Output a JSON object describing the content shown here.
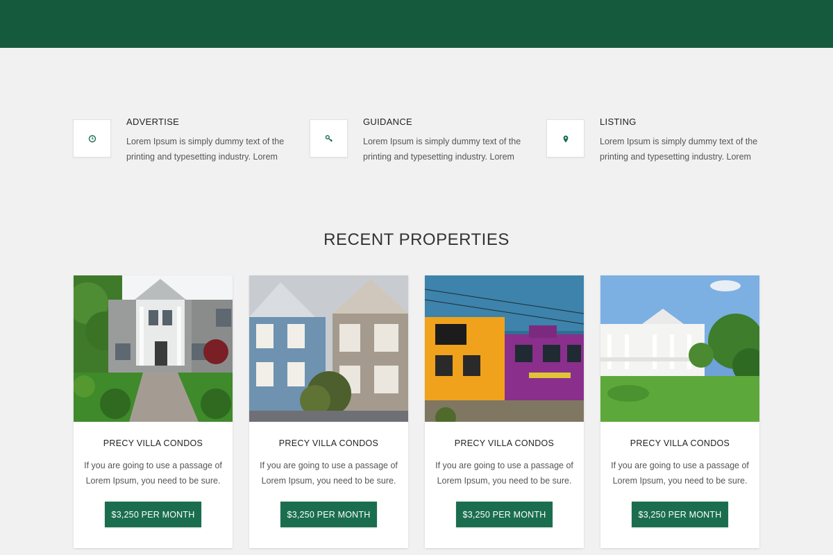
{
  "colors": {
    "header": "#165a3d",
    "accent": "#1a6e4f",
    "background": "#f1f1f1"
  },
  "features": [
    {
      "icon": "clock-icon",
      "title": "ADVERTISE",
      "text": "Lorem Ipsum is simply dummy text of the printing and typesetting industry. Lorem"
    },
    {
      "icon": "key-icon",
      "title": "GUIDANCE",
      "text": "Lorem Ipsum is simply dummy text of the printing and typesetting industry. Lorem"
    },
    {
      "icon": "map-pin-icon",
      "title": "LISTING",
      "text": "Lorem Ipsum is simply dummy text of the printing and typesetting industry. Lorem"
    }
  ],
  "recent": {
    "title": "RECENT PROPERTIES",
    "cards": [
      {
        "image": "suburban-house-photo",
        "title": "PRECY VILLA CONDOS",
        "text": "If you are going to use a passage of Lorem Ipsum, you need to be sure.",
        "price": "$3,250 PER MONTH"
      },
      {
        "image": "victorian-houses-photo",
        "title": "PRECY VILLA CONDOS",
        "text": "If you are going to use a passage of Lorem Ipsum, you need to be sure.",
        "price": "$3,250 PER MONTH"
      },
      {
        "image": "colorful-houses-photo",
        "title": "PRECY VILLA CONDOS",
        "text": "If you are going to use a passage of Lorem Ipsum, you need to be sure.",
        "price": "$3,250 PER MONTH"
      },
      {
        "image": "white-mansion-photo",
        "title": "PRECY VILLA CONDOS",
        "text": "If you are going to use a passage of Lorem Ipsum, you need to be sure.",
        "price": "$3,250 PER MONTH"
      }
    ]
  }
}
